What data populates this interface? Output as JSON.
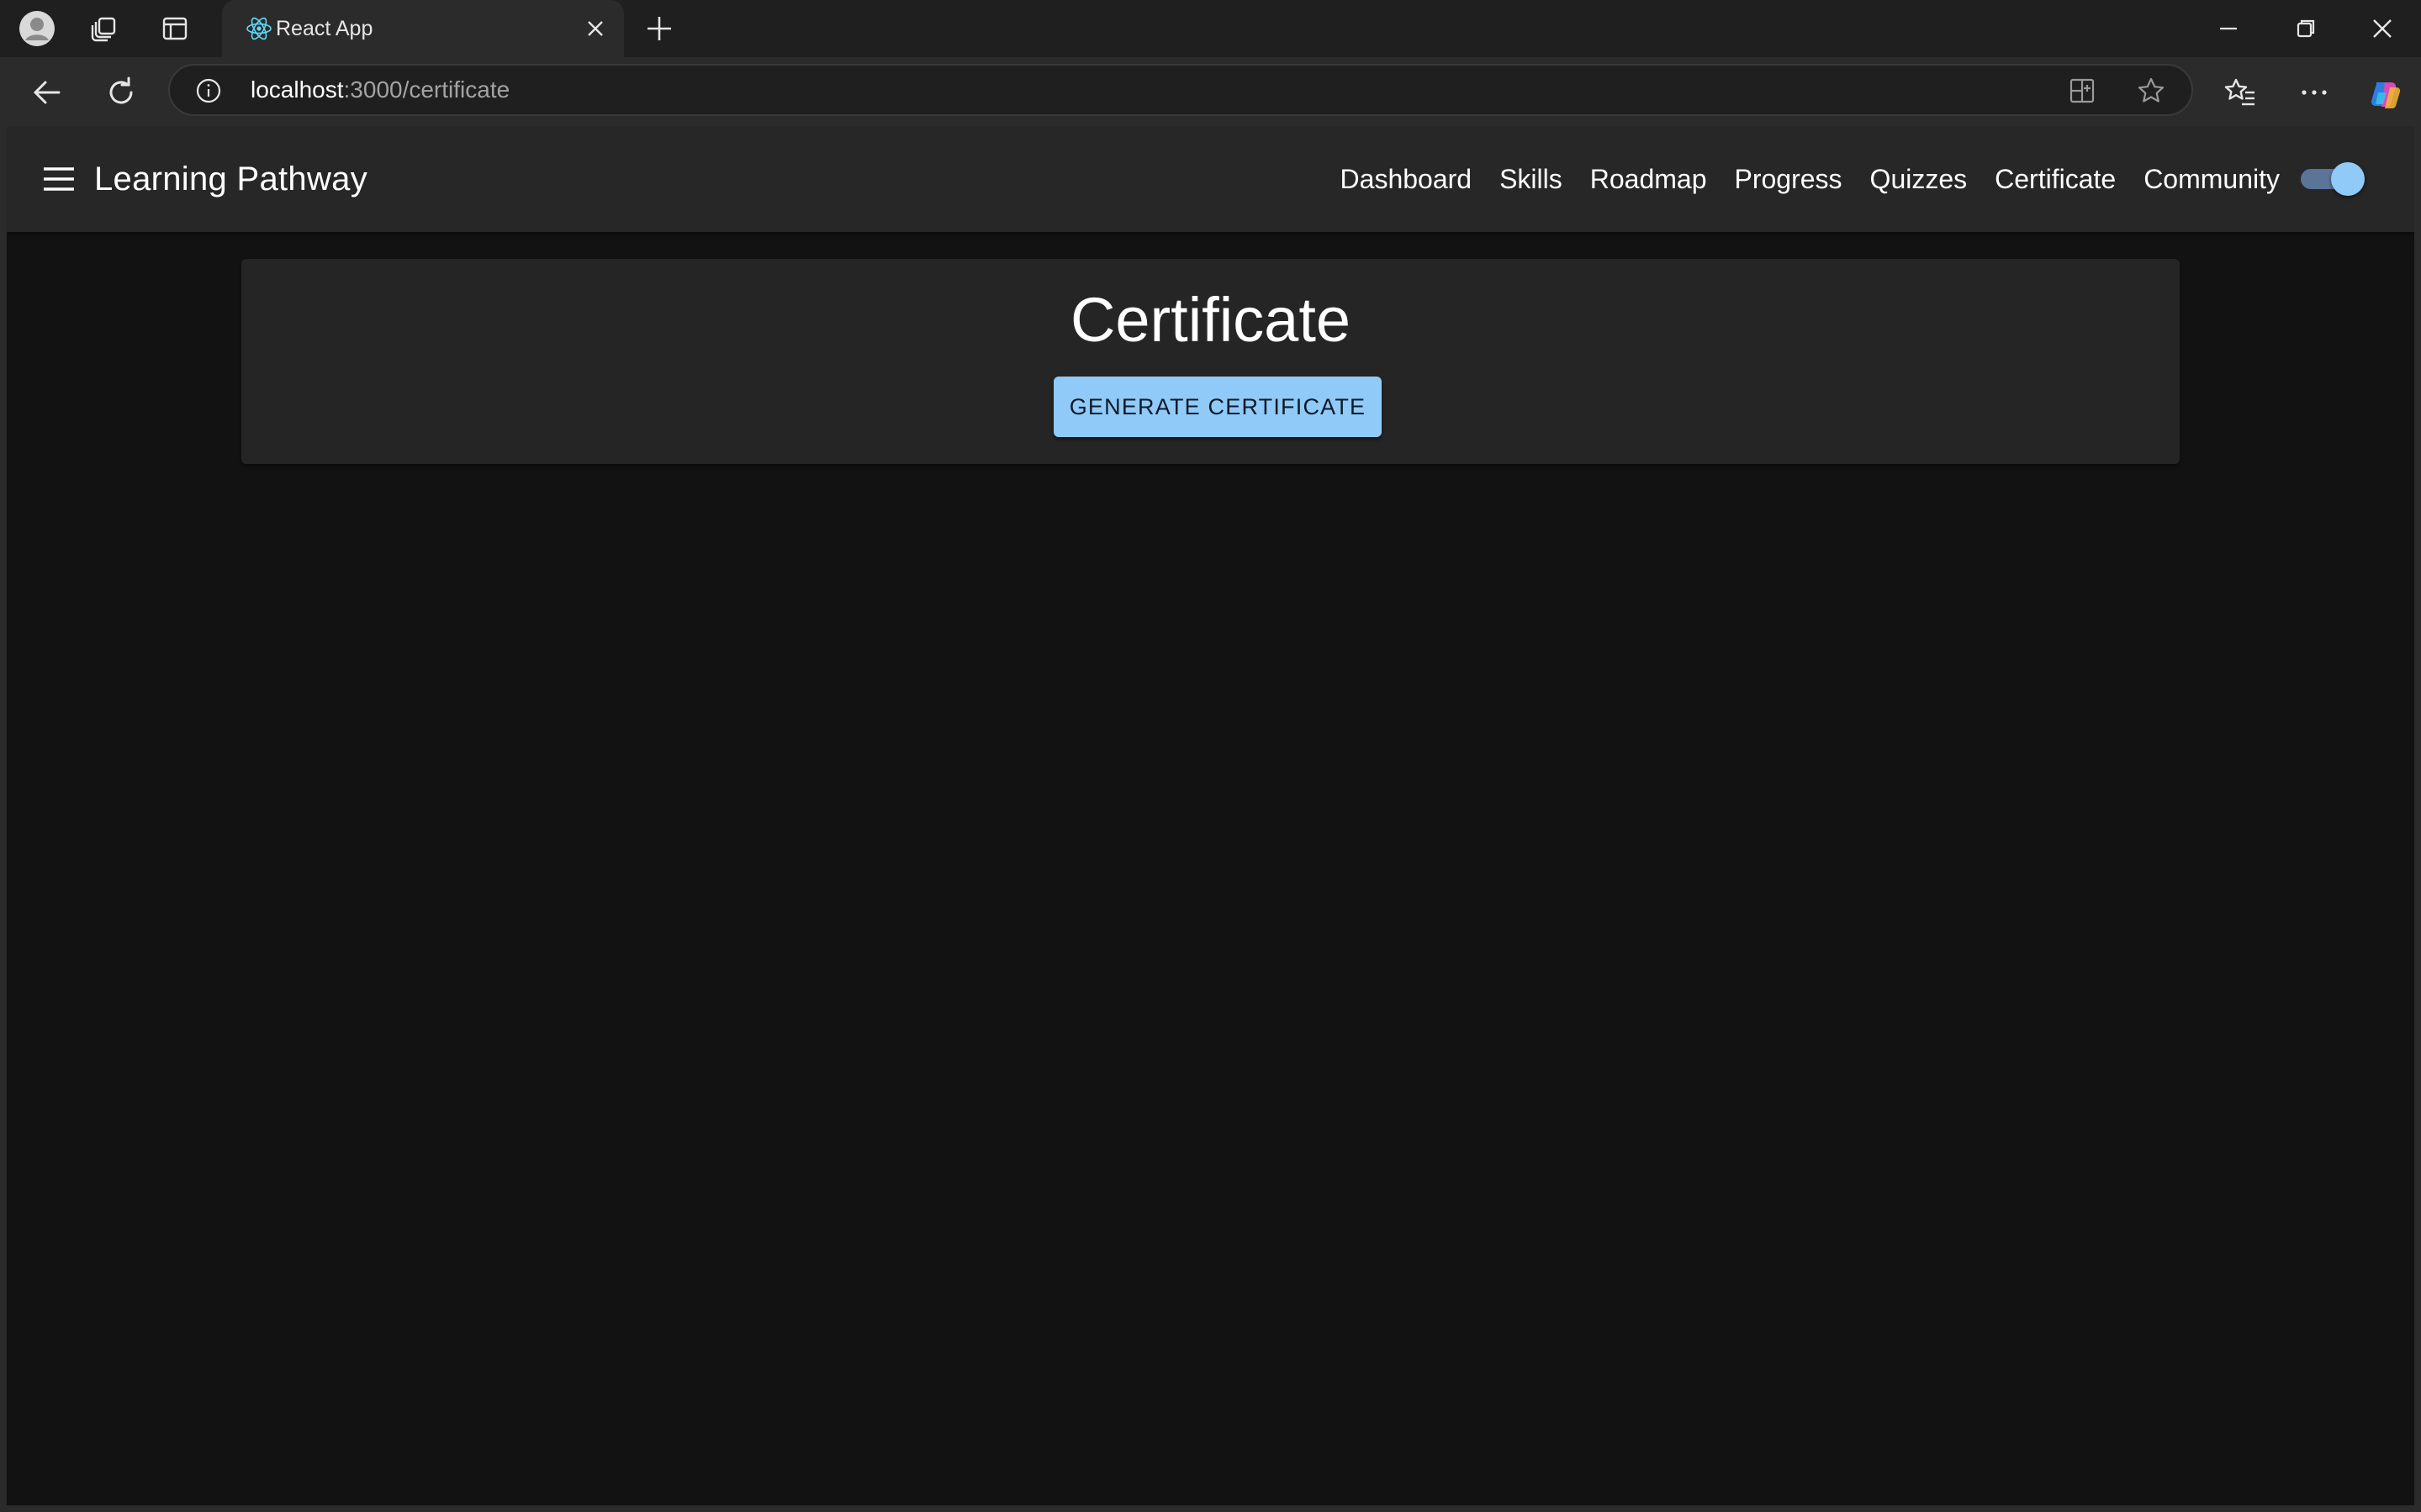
{
  "browser": {
    "tab": {
      "title": "React App",
      "favicon": "react-logo-icon"
    },
    "address": {
      "host": "localhost",
      "rest": ":3000/certificate"
    },
    "icons": {
      "profile": "profile-avatar-icon",
      "workspaces": "workspaces-icon",
      "tab_actions": "tab-actions-icon",
      "new_tab": "plus-icon",
      "back": "back-arrow-icon",
      "reload": "reload-icon",
      "site_info": "info-icon",
      "split_screen": "split-screen-icon",
      "favorite": "star-icon",
      "favorites": "favorites-icon",
      "more": "more-icon",
      "copilot": "copilot-icon",
      "minimize": "minimize-icon",
      "restore": "restore-icon",
      "close": "close-icon"
    }
  },
  "app": {
    "title": "Learning Pathway",
    "nav": [
      "Dashboard",
      "Skills",
      "Roadmap",
      "Progress",
      "Quizzes",
      "Certificate",
      "Community"
    ],
    "theme_toggle_on": true,
    "accent_color": "#90caf9"
  },
  "certificate": {
    "heading": "Certificate",
    "button_label": "GENERATE CERTIFICATE"
  }
}
